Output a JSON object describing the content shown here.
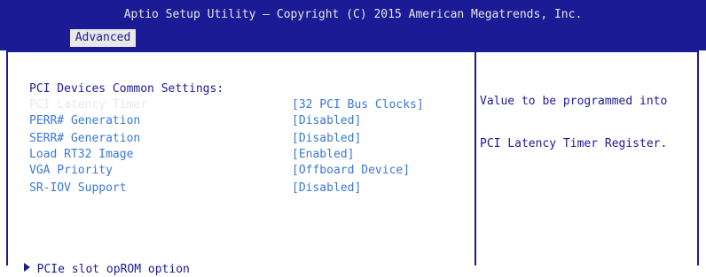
{
  "header": {
    "title": "Aptio Setup Utility – Copyright (C) 2015 American Megatrends, Inc.",
    "tab_active": "Advanced"
  },
  "section_title": "PCI Devices Common Settings:",
  "settings": [
    {
      "label": "PCI Latency Timer",
      "value": "[32 PCI Bus Clocks]",
      "selected": true
    },
    {
      "label": "PERR# Generation",
      "value": "[Disabled]"
    },
    {
      "label": "SERR# Generation",
      "value": "[Disabled]"
    },
    {
      "label": "Load RT32 Image",
      "value": "[Enabled]"
    },
    {
      "label": "VGA Priority",
      "value": "[Offboard Device]"
    },
    {
      "label": "SR-IOV Support",
      "value": "[Disabled]"
    }
  ],
  "submenu": {
    "label": "PCIe slot opROM option",
    "icon": "right-triangle-icon"
  },
  "help": {
    "line1": "Value to be programmed into",
    "line2": "PCI Latency Timer Register."
  },
  "colors": {
    "header_bg": "#1b1b96",
    "item_blue": "#3a78d8",
    "selected_text": "#e8e8e8",
    "dark_blue_text": "#1b1b96"
  }
}
